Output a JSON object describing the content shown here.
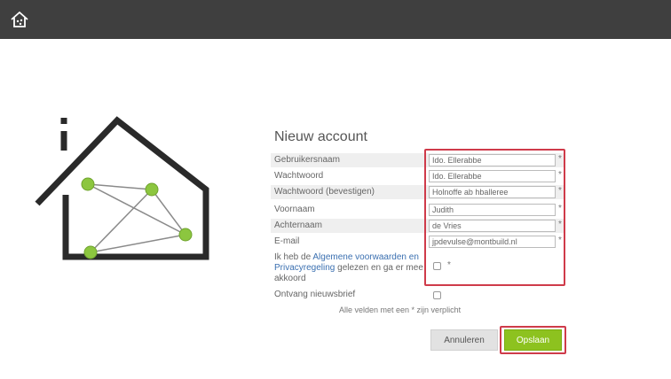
{
  "header": {
    "home_icon": "house-icon"
  },
  "logo": {
    "icon": "smart-home-network-logo",
    "node_color": "#8cc63f"
  },
  "form": {
    "title": "Nieuw account",
    "fields": [
      {
        "label": "Gebruikersnaam",
        "value": "Ido. Ellerabbe"
      },
      {
        "label": "Wachtwoord",
        "value": "Ido. Ellerabbe"
      },
      {
        "label": "Wachtwoord (bevestigen)",
        "value": "Holnoffe ab hballeree"
      },
      {
        "label": "Voornaam",
        "value": "Judith"
      },
      {
        "label": "Achternaam",
        "value": "de Vries"
      },
      {
        "label": "E-mail",
        "value": "jpdevulse@montbuild.nl"
      }
    ],
    "required_mark": "*",
    "terms": {
      "prefix": "Ik heb de ",
      "link": "Algemene voorwaarden en Privacyregeling",
      "suffix": " gelezen en ga er mee akkoord"
    },
    "newsletter_label": "Ontvang nieuwsbrief",
    "note": "Alle velden met een * zijn verplicht",
    "buttons": {
      "cancel": "Annuleren",
      "save": "Opslaan"
    }
  },
  "colors": {
    "highlight": "#cf3b4a",
    "accent": "#8dc21f",
    "topbar": "#3f3f3f"
  }
}
